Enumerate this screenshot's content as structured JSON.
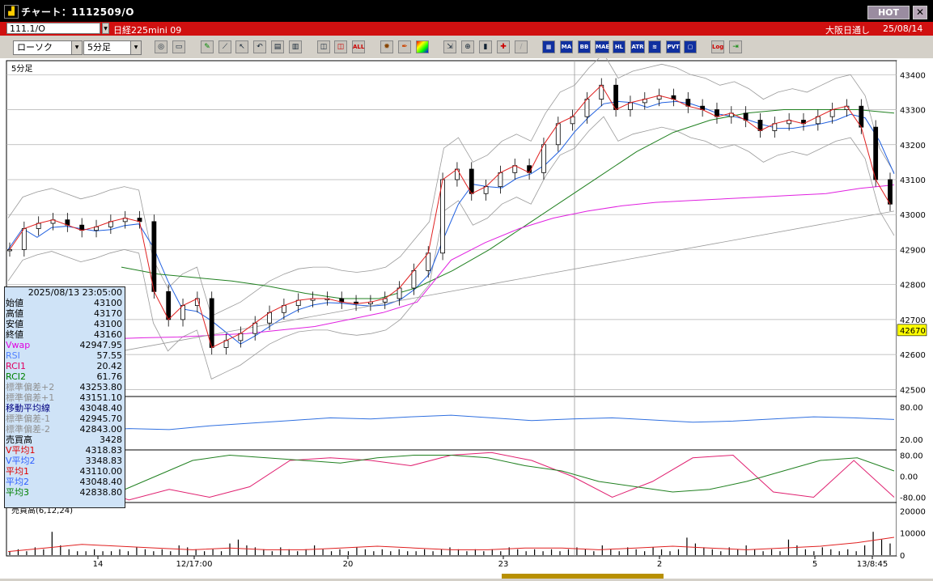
{
  "window": {
    "title": "チャート：1112509/O",
    "hot_label": "HOT",
    "close_label": "✕"
  },
  "infobar": {
    "symbol": "111.1/O",
    "market": "日経225mini 09",
    "session": "大阪日通し",
    "date": "25/08/14"
  },
  "toolbar": {
    "chart_type": "ローソク",
    "interval": "5分足",
    "icons": [
      "search-icon",
      "window-icon",
      "pencil-icon",
      "trend-line-icon",
      "cursor-icon",
      "undo-icon",
      "note-icon",
      "trash-icon",
      "candle-add-icon",
      "candle-remove-icon",
      "all-icon",
      "settings-icon",
      "tools-icon",
      "color-icon",
      "export-icon",
      "zoom-icon",
      "bar-chart-icon",
      "indicator-icon",
      "disabled-icon",
      "grid-icon",
      "ma-icon",
      "bb-icon",
      "mae-icon",
      "hl-icon",
      "atr-icon",
      "rsi-icon",
      "pvt-icon",
      "frame-icon",
      "log-icon",
      "exit-icon"
    ],
    "text_buttons": {
      "all": "ALL",
      "ma": "MA",
      "bb": "BB",
      "mae": "MAE",
      "hl": "HL",
      "atr": "ATR",
      "pvt": "PVT",
      "log": "Log"
    }
  },
  "chart": {
    "interval_label": "5分足",
    "price_tick_labels": [
      "43400",
      "43300",
      "43200",
      "43100",
      "43000",
      "42900",
      "42800",
      "42700",
      "42600",
      "42500"
    ],
    "current_price": "42670",
    "sub1_tick_labels": [
      "80.00",
      "20.00"
    ],
    "sub2_tick_labels": [
      "80.00",
      "0.00",
      "-80.00"
    ],
    "volume_title": "売買高(6,12,24)",
    "volume_tick_labels": [
      "20000",
      "10000",
      "0"
    ],
    "x_tick_labels": [
      "14",
      "12/17:00",
      "20",
      "23",
      "2",
      "5",
      "13/8:45"
    ],
    "colors": {
      "candle_up": "#ffffff",
      "candle_down": "#000000",
      "ma_short": "#e02020",
      "ma_mid": "#2060e0",
      "ma_long": "#208020",
      "vwap": "#e020e0",
      "bands": "#999999",
      "rsi": "#3070e0",
      "rci1": "#e02070",
      "rci2": "#208020"
    }
  },
  "panel": {
    "datetime": "2025/08/13 23:05:00",
    "rows": [
      {
        "label": "始値",
        "value": "43100",
        "color": "#000000"
      },
      {
        "label": "高値",
        "value": "43170",
        "color": "#000000"
      },
      {
        "label": "安値",
        "value": "43100",
        "color": "#000000"
      },
      {
        "label": "終値",
        "value": "43160",
        "color": "#000000"
      },
      {
        "label": "Vwap",
        "value": "42947.95",
        "color": "#e000e0"
      },
      {
        "label": "RSI",
        "value": "57.55",
        "color": "#5080ff"
      },
      {
        "label": "RCI1",
        "value": "20.42",
        "color": "#e00060"
      },
      {
        "label": "RCI2",
        "value": "61.76",
        "color": "#008000"
      },
      {
        "label": "標準偏差+2",
        "value": "43253.80",
        "color": "#909090"
      },
      {
        "label": "標準偏差+1",
        "value": "43151.10",
        "color": "#909090"
      },
      {
        "label": "移動平均線",
        "value": "43048.40",
        "color": "#000080"
      },
      {
        "label": "標準偏差-1",
        "value": "42945.70",
        "color": "#909090"
      },
      {
        "label": "標準偏差-2",
        "value": "42843.00",
        "color": "#909090"
      },
      {
        "label": "売買高",
        "value": "3428",
        "color": "#000000"
      },
      {
        "label": "V平均1",
        "value": "4318.83",
        "color": "#e00000"
      },
      {
        "label": "V平均2",
        "value": "3348.83",
        "color": "#3060ff"
      },
      {
        "label": "平均1",
        "value": "43110.00",
        "color": "#e00000"
      },
      {
        "label": "平均2",
        "value": "43048.40",
        "color": "#3060ff"
      },
      {
        "label": "平均3",
        "value": "42838.80",
        "color": "#008000"
      }
    ]
  },
  "chart_data": {
    "type": "candlestick",
    "interval": "5分足",
    "y_range": [
      42480,
      43440
    ],
    "x_tick_labels": [
      "14",
      "12/17:00",
      "20",
      "23",
      "2",
      "5",
      "13/8:45"
    ],
    "close_points": [
      42900,
      42960,
      42975,
      42985,
      42970,
      42955,
      42965,
      42980,
      42990,
      42980,
      42780,
      42700,
      42740,
      42760,
      42620,
      42640,
      42660,
      42690,
      42720,
      42740,
      42755,
      42760,
      42760,
      42750,
      42745,
      42750,
      42760,
      42790,
      42840,
      42890,
      43100,
      43130,
      43060,
      43080,
      43120,
      43140,
      43120,
      43200,
      43260,
      43280,
      43330,
      43370,
      43300,
      43320,
      43330,
      43340,
      43330,
      43310,
      43300,
      43280,
      43290,
      43270,
      43240,
      43260,
      43270,
      43260,
      43280,
      43300,
      43310,
      43250,
      43100,
      43030
    ],
    "vwap_points": [
      42640,
      42640,
      42642,
      42645,
      42648,
      42650,
      42655,
      42660,
      42670,
      42680,
      42700,
      42720,
      42750,
      42870,
      42920,
      42960,
      42990,
      43010,
      43025,
      43035,
      43040,
      43045,
      43050,
      43055,
      43060,
      43075,
      43085
    ],
    "ma_long_points": [
      42850,
      42830,
      42820,
      42810,
      42795,
      42775,
      42760,
      42760,
      42790,
      42840,
      42900,
      42970,
      43040,
      43110,
      43180,
      43235,
      43270,
      43290,
      43300,
      43300,
      43300,
      43290
    ],
    "rsi_points": [
      20,
      30,
      35,
      40,
      38,
      45,
      50,
      55,
      60,
      58,
      62,
      65,
      60,
      55,
      58,
      60,
      56,
      52,
      54,
      58,
      62,
      60,
      57
    ],
    "rci1_points": [
      -60,
      -80,
      -40,
      -90,
      -50,
      -80,
      -40,
      60,
      70,
      60,
      40,
      80,
      90,
      60,
      0,
      -80,
      -20,
      70,
      80,
      -60,
      -80,
      60,
      -80
    ],
    "rci2_points": [
      -50,
      -80,
      -80,
      -60,
      0,
      60,
      80,
      70,
      60,
      50,
      70,
      80,
      80,
      70,
      40,
      20,
      -20,
      -40,
      -60,
      -50,
      -20,
      20,
      60,
      70,
      20
    ],
    "volume_peak_ticks": [
      "14",
      "12/17:00",
      "20",
      "23",
      "2",
      "5",
      "13/8:45"
    ]
  }
}
